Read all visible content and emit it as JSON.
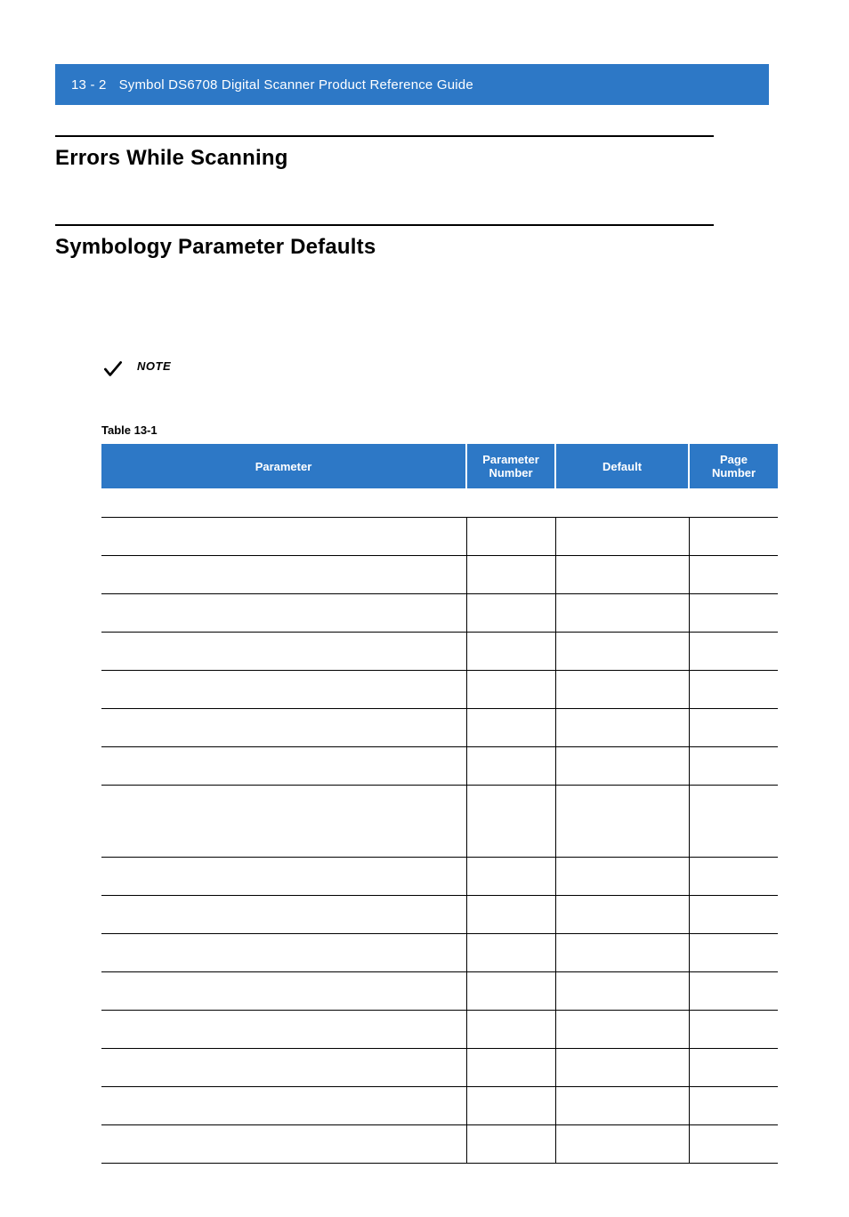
{
  "header": {
    "page_number": "13 - 2",
    "doc_title": "Symbol DS6708 Digital Scanner Product Reference Guide"
  },
  "sections": {
    "errors_title": "Errors While Scanning",
    "defaults_title": "Symbology Parameter Defaults"
  },
  "note": {
    "label": "NOTE"
  },
  "table": {
    "caption": "Table 13-1",
    "headers": {
      "parameter": "Parameter",
      "parameter_number": "Parameter\nNumber",
      "default": "Default",
      "page_number": "Page\nNumber"
    },
    "rows": [
      {
        "type": "section",
        "parameter": "",
        "parameter_number": "",
        "default": "",
        "page_number": ""
      },
      {
        "type": "data",
        "parameter": "",
        "parameter_number": "",
        "default": "",
        "page_number": ""
      },
      {
        "type": "data",
        "parameter": "",
        "parameter_number": "",
        "default": "",
        "page_number": ""
      },
      {
        "type": "data",
        "parameter": "",
        "parameter_number": "",
        "default": "",
        "page_number": ""
      },
      {
        "type": "data",
        "parameter": "",
        "parameter_number": "",
        "default": "",
        "page_number": ""
      },
      {
        "type": "data",
        "parameter": "",
        "parameter_number": "",
        "default": "",
        "page_number": ""
      },
      {
        "type": "data",
        "parameter": "",
        "parameter_number": "",
        "default": "",
        "page_number": ""
      },
      {
        "type": "data",
        "parameter": "",
        "parameter_number": "",
        "default": "",
        "page_number": ""
      },
      {
        "type": "tall",
        "parameter": "",
        "parameter_number": "",
        "default": "",
        "page_number": ""
      },
      {
        "type": "data",
        "parameter": "",
        "parameter_number": "",
        "default": "",
        "page_number": ""
      },
      {
        "type": "data",
        "parameter": "",
        "parameter_number": "",
        "default": "",
        "page_number": ""
      },
      {
        "type": "data",
        "parameter": "",
        "parameter_number": "",
        "default": "",
        "page_number": ""
      },
      {
        "type": "data",
        "parameter": "",
        "parameter_number": "",
        "default": "",
        "page_number": ""
      },
      {
        "type": "data",
        "parameter": "",
        "parameter_number": "",
        "default": "",
        "page_number": ""
      },
      {
        "type": "data",
        "parameter": "",
        "parameter_number": "",
        "default": "",
        "page_number": ""
      },
      {
        "type": "data",
        "parameter": "",
        "parameter_number": "",
        "default": "",
        "page_number": ""
      },
      {
        "type": "data",
        "parameter": "",
        "parameter_number": "",
        "default": "",
        "page_number": ""
      }
    ]
  }
}
